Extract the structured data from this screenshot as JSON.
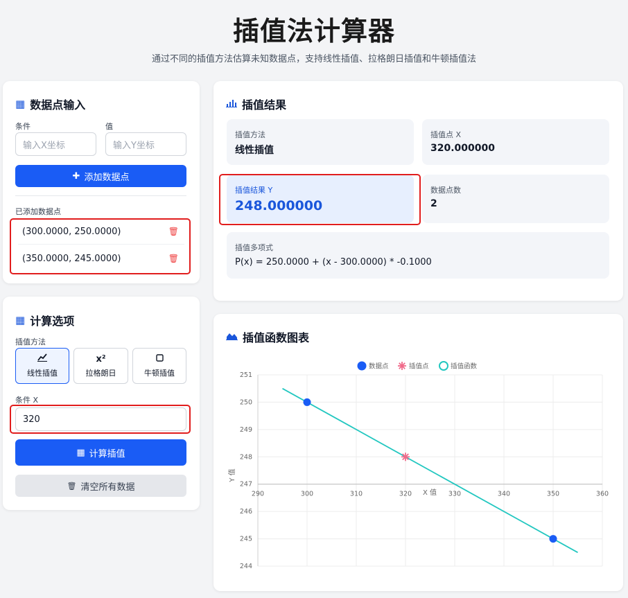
{
  "header": {
    "title": "插值法计算器",
    "subtitle": "通过不同的插值方法估算未知数据点，支持线性插值、拉格朗日插值和牛顿插值法"
  },
  "input_card": {
    "title": "数据点输入",
    "x_label": "条件",
    "y_label": "值",
    "x_placeholder": "输入X坐标",
    "y_placeholder": "输入Y坐标",
    "add_button": "添加数据点",
    "list_title": "已添加数据点",
    "points": [
      "(300.0000, 250.0000)",
      "(350.0000, 245.0000)"
    ]
  },
  "options_card": {
    "title": "计算选项",
    "method_label": "插值方法",
    "methods": [
      {
        "icon": "line-chart-icon",
        "symbol": "📈",
        "label": "线性插值",
        "active": true
      },
      {
        "icon": "x-squared-icon",
        "symbol": "x²",
        "label": "拉格朗日",
        "active": false
      },
      {
        "icon": "square-icon",
        "symbol": "☐",
        "label": "牛顿插值",
        "active": false
      }
    ],
    "x_label": "条件 X",
    "x_value": "320",
    "calc_button": "计算插值",
    "clear_button": "清空所有数据"
  },
  "result_card": {
    "title": "插值结果",
    "method_label": "插值方法",
    "method_value": "线性插值",
    "x_label": "插值点 X",
    "x_value": "320.000000",
    "y_label": "插值结果 Y",
    "y_value": "248.000000",
    "count_label": "数据点数",
    "count_value": "2",
    "poly_label": "插值多项式",
    "poly_value": "P(x) = 250.0000 + (x - 300.0000) * -0.1000"
  },
  "chart_card": {
    "title": "插值函数图表"
  },
  "colors": {
    "accent": "#1a5cf5",
    "highlight_border": "#e11d1d",
    "point": "#1a5cf5",
    "interp_point": "#f06a8a",
    "curve": "#22c7c0"
  },
  "chart_data": {
    "type": "line",
    "xlabel": "X 值",
    "ylabel": "Y 值",
    "xlim": [
      290,
      360
    ],
    "ylim": [
      244,
      251
    ],
    "xticks": [
      "290",
      "300",
      "310",
      "320",
      "330",
      "340",
      "350",
      "360"
    ],
    "yticks": [
      "244",
      "245",
      "246",
      "247",
      "248",
      "249",
      "250",
      "251"
    ],
    "legend": [
      "数据点",
      "插值点",
      "插值函数"
    ],
    "legend_position": "top",
    "grid": true,
    "series": [
      {
        "name": "数据点",
        "kind": "scatter",
        "x": [
          300,
          350
        ],
        "y": [
          250,
          245
        ]
      },
      {
        "name": "插值点",
        "kind": "star",
        "x": [
          320
        ],
        "y": [
          248
        ]
      },
      {
        "name": "插值函数",
        "kind": "line",
        "x": [
          295,
          355
        ],
        "y": [
          250.5,
          244.5
        ]
      }
    ]
  }
}
